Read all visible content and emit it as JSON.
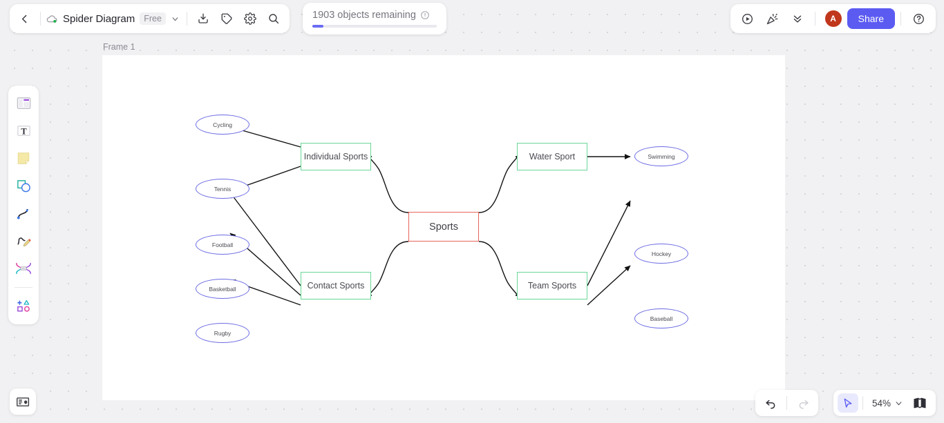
{
  "topbar": {
    "back_icon": "chevron-left-icon",
    "cloud_icon": "cloud-saved-icon",
    "doc_title": "Spider Diagram",
    "plan_badge": "Free",
    "title_chevron": "chevron-down-icon",
    "actions": [
      {
        "name": "import-button",
        "icon": "download-import-icon"
      },
      {
        "name": "tag-button",
        "icon": "tag-icon"
      },
      {
        "name": "settings-button",
        "icon": "gear-icon"
      },
      {
        "name": "search-button",
        "icon": "search-icon"
      }
    ]
  },
  "toast": {
    "text": "1903 objects remaining",
    "info_icon": "info-circle-icon",
    "progress_percent": 9
  },
  "topbar_right": {
    "present_icon": "play-circle-icon",
    "celebrate_icon": "confetti-icon",
    "collapse_icon": "double-chevron-down-icon",
    "avatar_initial": "A",
    "avatar_color": "#c0371c",
    "share_label": "Share",
    "share_color": "#5b5bf2",
    "help_icon": "question-circle-icon"
  },
  "tool_rail": [
    {
      "name": "tool-templates",
      "icon": "template-layout-icon"
    },
    {
      "name": "tool-text",
      "icon": "text-t-icon"
    },
    {
      "name": "tool-sticky-note",
      "icon": "sticky-note-icon"
    },
    {
      "name": "tool-shapes",
      "icon": "square-circle-shapes-icon"
    },
    {
      "name": "tool-connector",
      "icon": "curved-connector-icon"
    },
    {
      "name": "tool-pen",
      "icon": "pen-draw-icon"
    },
    {
      "name": "tool-frame",
      "icon": "frame-mindmap-icon"
    },
    {
      "name": "tool-more-shapes",
      "icon": "plus-shapes-icon"
    }
  ],
  "tips_button": {
    "icon": "tips-card-icon"
  },
  "bottom_controls": {
    "undo_icon": "undo-arrow-icon",
    "redo_icon": "redo-arrow-icon",
    "redo_disabled": true,
    "cursor_icon": "cursor-pointer-icon",
    "zoom_level": "54%",
    "zoom_chevron": "chevron-down-icon",
    "minimap_icon": "minimap-book-icon"
  },
  "canvas": {
    "frame_label": "Frame 1"
  },
  "chart_data": {
    "type": "diagram",
    "title": "Spider Diagram",
    "root": {
      "label": "Sports",
      "shape": "rect",
      "color": "#e8635a"
    },
    "categories": [
      {
        "label": "Individual Sports",
        "shape": "rect",
        "color": "#69d696",
        "children": [
          {
            "label": "Cycling",
            "shape": "ellipse",
            "color": "#6a6ae4"
          },
          {
            "label": "Tennis",
            "shape": "ellipse",
            "color": "#6a6ae4"
          }
        ]
      },
      {
        "label": "Water Sport",
        "shape": "rect",
        "color": "#69d696",
        "children": [
          {
            "label": "Swimming",
            "shape": "ellipse",
            "color": "#6a6ae4"
          }
        ]
      },
      {
        "label": "Contact Sports",
        "shape": "rect",
        "color": "#69d696",
        "children": [
          {
            "label": "Football",
            "shape": "ellipse",
            "color": "#6a6ae4"
          },
          {
            "label": "Basketball",
            "shape": "ellipse",
            "color": "#6a6ae4"
          },
          {
            "label": "Rugby",
            "shape": "ellipse",
            "color": "#6a6ae4"
          }
        ]
      },
      {
        "label": "Team Sports",
        "shape": "rect",
        "color": "#69d696",
        "children": [
          {
            "label": "Hockey",
            "shape": "ellipse",
            "color": "#6a6ae4"
          },
          {
            "label": "Baseball",
            "shape": "ellipse",
            "color": "#6a6ae4"
          }
        ]
      }
    ]
  }
}
